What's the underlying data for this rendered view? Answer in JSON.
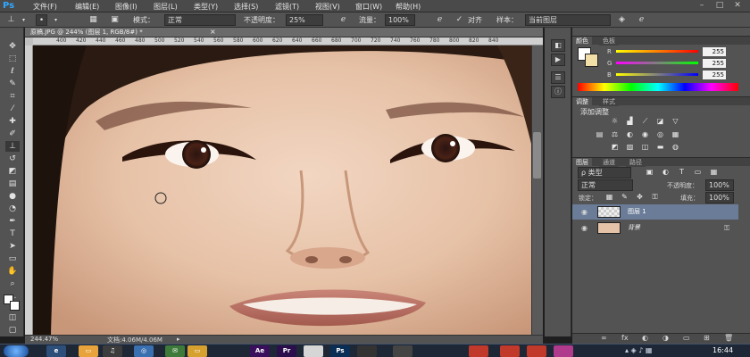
{
  "app": {
    "logo": "Ps"
  },
  "menubar": {
    "items": [
      "文件(F)",
      "编辑(E)",
      "图像(I)",
      "图层(L)",
      "类型(Y)",
      "选择(S)",
      "滤镜(T)",
      "视图(V)",
      "窗口(W)",
      "帮助(H)"
    ],
    "window_controls": [
      "–",
      "□",
      "✕"
    ]
  },
  "options": {
    "mode_label": "模式：",
    "mode_value": "正常",
    "opacity_label": "不透明度：",
    "opacity_value": "25%",
    "flow_label": "流量：",
    "flow_value": "100%",
    "align_label": "对齐",
    "sample_label": "样本：",
    "sample_value": "当前图层"
  },
  "document": {
    "tab_title": "原稿.JPG @ 244% (图层 1, RGB/8#) *",
    "tab_close": "×",
    "ruler_top_ticks": [
      "400",
      "420",
      "440",
      "460",
      "480",
      "500",
      "520",
      "540",
      "560",
      "580",
      "600",
      "620",
      "640",
      "660",
      "680",
      "700",
      "720",
      "740",
      "760",
      "780",
      "800",
      "820",
      "840"
    ],
    "zoom": "244.47%",
    "doc_info": "文档:4.06M/4.06M"
  },
  "color_panel": {
    "tabs": [
      "颜色",
      "色板"
    ],
    "channels": [
      {
        "label": "R",
        "value": "255",
        "color": "#ff0000"
      },
      {
        "label": "G",
        "value": "255",
        "color": "#00ff00"
      },
      {
        "label": "B",
        "value": "255",
        "color": "#0000ff"
      }
    ]
  },
  "adjust_panel": {
    "tabs": [
      "调整",
      "样式"
    ],
    "title": "添加调整"
  },
  "layers_panel": {
    "tabs": [
      "图层",
      "通道",
      "路径"
    ],
    "filter_label": "ρ 类型",
    "blend_mode": "正常",
    "opacity_label": "不透明度：",
    "opacity_value": "100%",
    "lock_label": "锁定：",
    "fill_label": "填充：",
    "fill_value": "100%",
    "layers": [
      {
        "name": "图层 1",
        "visible": true,
        "selected": true
      },
      {
        "name": "背景",
        "visible": true,
        "selected": false,
        "locked": true
      }
    ],
    "footer_icons": [
      "∞",
      "fx",
      "◐",
      "◑",
      "▭",
      "⊞",
      "🗑"
    ]
  },
  "taskbar": {
    "time": "16:44",
    "apps": [
      {
        "label": "Ae",
        "color": "#3a0f5c"
      },
      {
        "label": "Pr",
        "color": "#2b0f4d"
      },
      {
        "label": "",
        "color": "#d6d6d6"
      },
      {
        "label": "Ps",
        "color": "#0a2f57"
      },
      {
        "label": "",
        "color": "#333333"
      },
      {
        "label": "",
        "color": "#444444"
      },
      {
        "label": "",
        "color": "#c0392b"
      },
      {
        "label": "",
        "color": "#c0392b"
      },
      {
        "label": "",
        "color": "#c0392b"
      },
      {
        "label": "",
        "color": "#b03a8c"
      }
    ]
  }
}
